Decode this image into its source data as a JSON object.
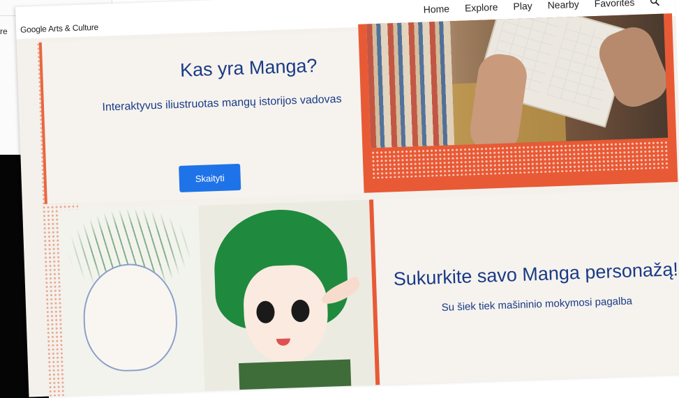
{
  "background": {
    "fragment_text": "re"
  },
  "app": {
    "brand": "Google Arts & Culture",
    "nav": [
      "Home",
      "Explore",
      "Play",
      "Nearby",
      "Favorites"
    ],
    "search_icon": "search-icon"
  },
  "card1": {
    "title": "Kas yra Manga?",
    "subtitle": "Interaktyvus iliustruotas mangų istorijos vadovas",
    "button": "Skaityti"
  },
  "card2": {
    "title": "Sukurkite savo Manga personažą!",
    "subtitle": "Su šiek tiek mašininio mokymosi pagalba"
  },
  "colors": {
    "accent": "#e85a35",
    "title_blue": "#1a3a86",
    "button_blue": "#1f73e8"
  }
}
